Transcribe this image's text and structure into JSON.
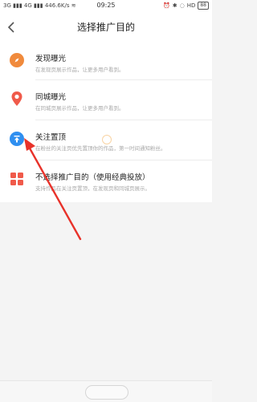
{
  "status_bar": {
    "signal_left": "3G",
    "signal_right": "4G",
    "speed": "446.6K/s",
    "time": "09:25",
    "network": "HD",
    "battery": "88"
  },
  "header": {
    "title": "选择推广目的"
  },
  "options": [
    {
      "title": "发现曝光",
      "desc": "在发现页展示作品，让更多用户看到。",
      "icon": "compass-icon",
      "color": "#f08a3c"
    },
    {
      "title": "同城曝光",
      "desc": "在同城页展示作品，让更多用户看到。",
      "icon": "location-pin-icon",
      "color": "#f05a4a"
    },
    {
      "title": "关注置顶",
      "desc": "在粉丝的关注页优先置顶你的作品，第一时间通知粉丝。",
      "icon": "pin-top-icon",
      "color": "#2f8ff0"
    },
    {
      "title": "不选择推广目的（使用经典投放）",
      "desc": "支持作品在关注页置顶，在发现页和同城页展示。",
      "icon": "grid-icon",
      "color": "#f05a4a"
    }
  ]
}
